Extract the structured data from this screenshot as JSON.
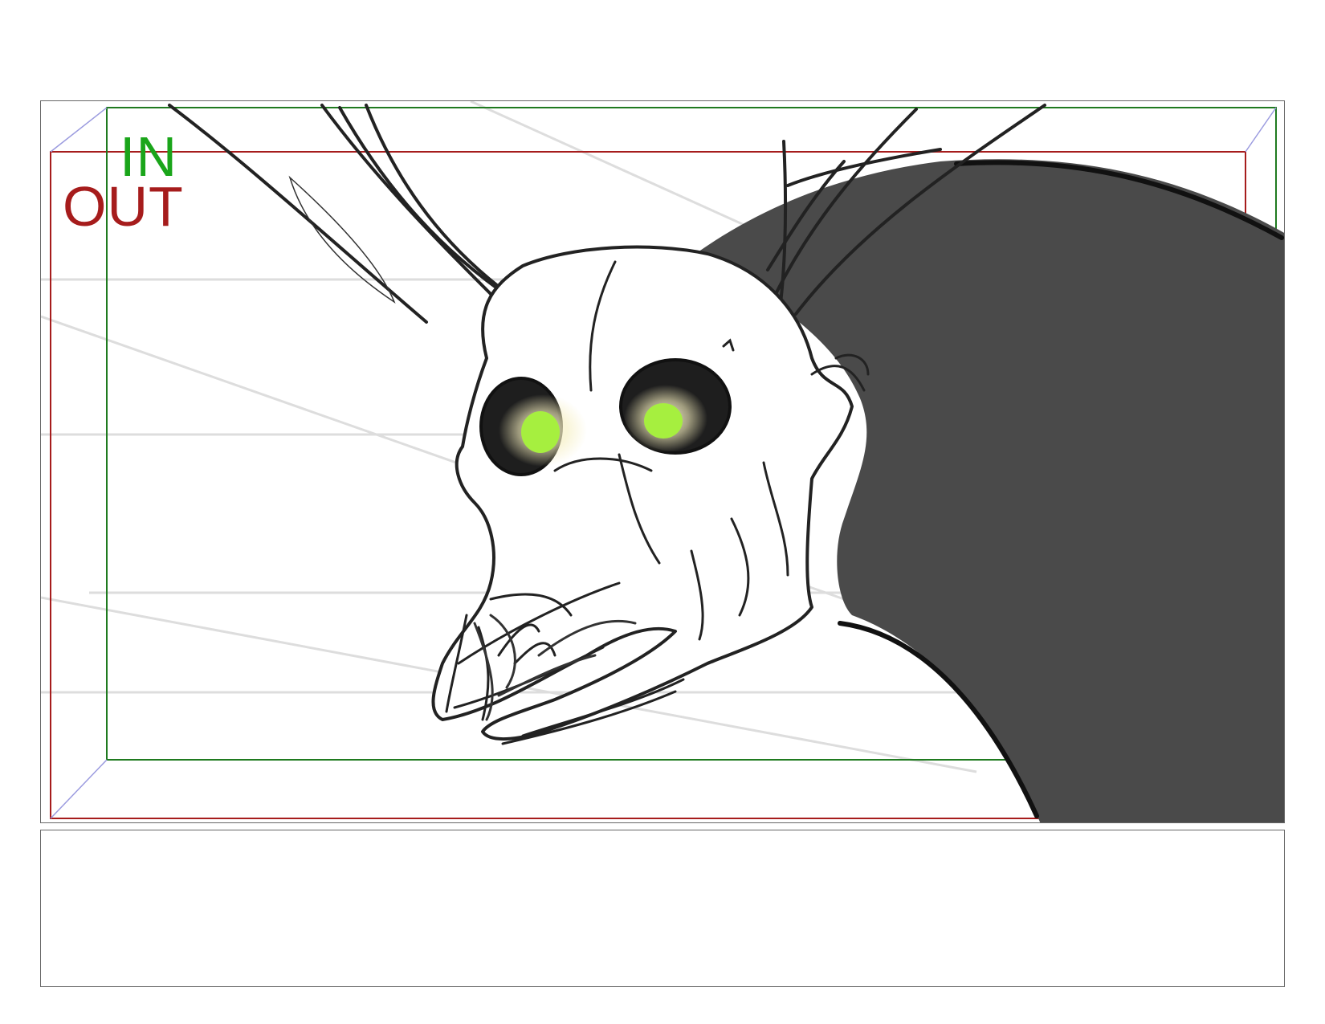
{
  "frame_labels": {
    "in": "IN",
    "out": "OUT"
  },
  "colors": {
    "in_frame": "#1f7a1f",
    "in_text": "#1aa51a",
    "out_frame": "#a61c1c",
    "out_text": "#a61c1c",
    "creature_fill": "#4a4a4a",
    "stroke": "#222222",
    "eye_glow": "#a6ef3f",
    "guide_line": "#dddddd",
    "perspective_line": "#9b9bdf"
  },
  "notes": {
    "text": ""
  }
}
